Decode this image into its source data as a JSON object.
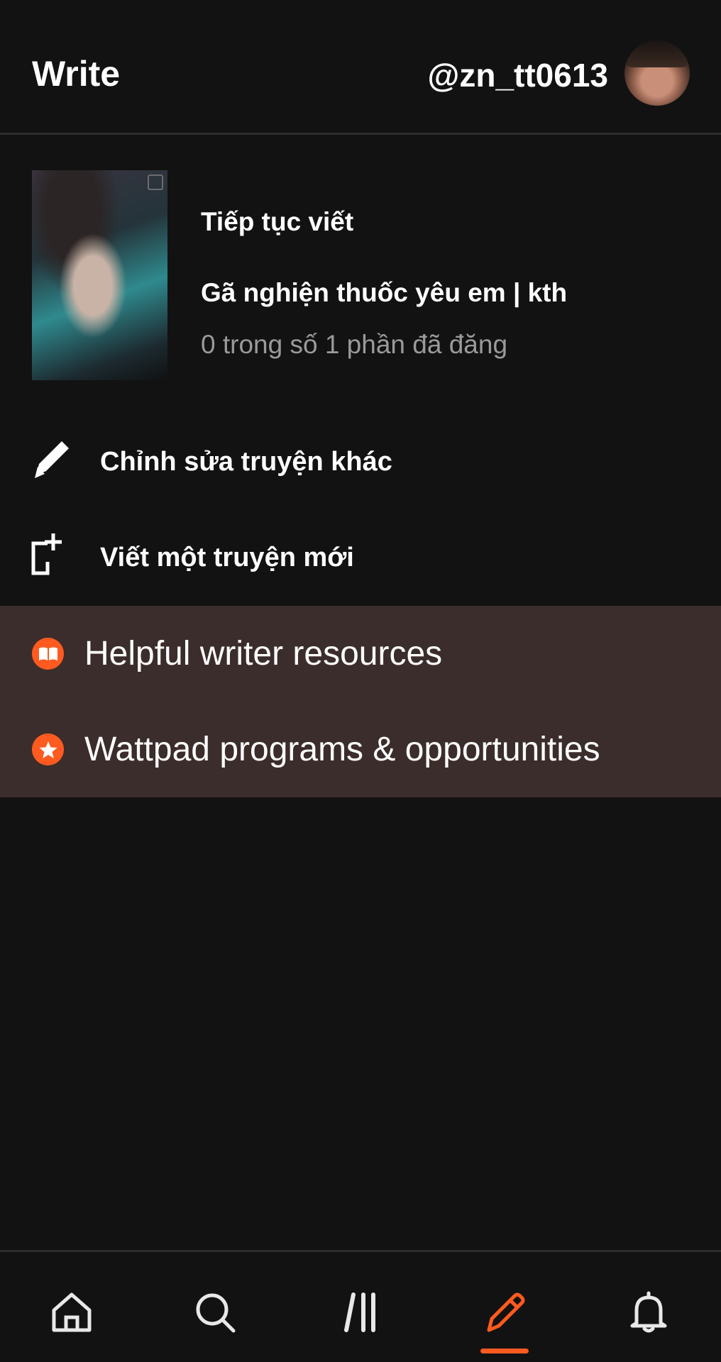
{
  "header": {
    "title": "Write",
    "username": "@zn_tt0613"
  },
  "continue_writing": {
    "label": "Tiếp tục viết",
    "story_title": "Gã nghiện thuốc yêu em | kth",
    "status": "0 trong số 1 phần đã đăng"
  },
  "actions": {
    "edit_other": "Chỉnh sửa truyện khác",
    "write_new": "Viết một truyện mới"
  },
  "resources": [
    {
      "label": "Helpful writer resources",
      "icon": "book-icon"
    },
    {
      "label": "Wattpad programs & opportunities",
      "icon": "star-icon"
    }
  ],
  "bottom_nav": [
    {
      "name": "home",
      "icon": "home-icon"
    },
    {
      "name": "search",
      "icon": "search-icon"
    },
    {
      "name": "library",
      "icon": "library-icon"
    },
    {
      "name": "write",
      "icon": "pencil-icon",
      "active": true
    },
    {
      "name": "notifications",
      "icon": "bell-icon"
    }
  ],
  "colors": {
    "background": "#121212",
    "accent": "#ff5a1f",
    "resources_bg": "#3b2d2b",
    "muted_text": "#9a9a9a"
  }
}
